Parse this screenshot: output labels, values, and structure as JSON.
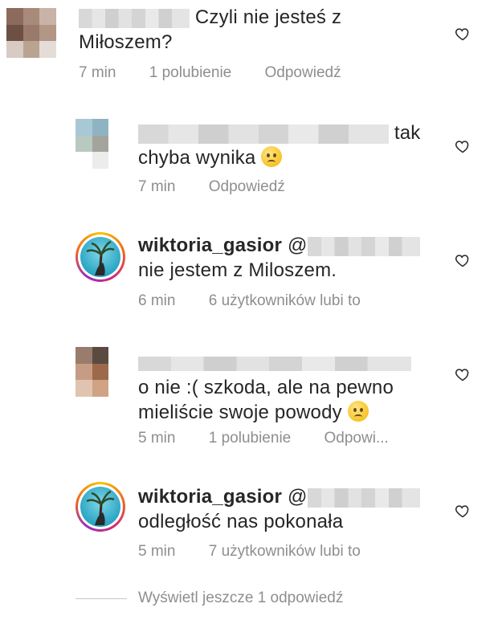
{
  "comments": [
    {
      "text1": "Czyli nie jesteś z",
      "text2": "Miłoszem?",
      "time": "7 min",
      "likes": "1 polubienie",
      "reply": "Odpowiedź"
    },
    {
      "text1": "tak",
      "text2": "chyba wynika",
      "time": "7 min",
      "reply": "Odpowiedź"
    },
    {
      "username": "wiktoria_gasior",
      "mention_prefix": "@",
      "text2": "nie jestem z Miloszem.",
      "time": "6 min",
      "likes": "6 użytkowników lubi to"
    },
    {
      "text1": "o nie :( szkoda, ale na pewno",
      "text2": "mieliście swoje powody",
      "time": "5 min",
      "likes": "1 polubienie",
      "reply": "Odpowi..."
    },
    {
      "username": "wiktoria_gasior",
      "mention_prefix": "@",
      "text2": "odległość nas pokonała",
      "time": "5 min",
      "likes": "7 użytkowników lubi to"
    }
  ],
  "view_more": "Wyświetl jeszcze 1 odpowiedź",
  "icons": {
    "like": "heart-outline-icon",
    "sad": "sad-face-emoji-icon"
  },
  "colors": {
    "meta": "#8e8e8e",
    "text": "#262626"
  }
}
